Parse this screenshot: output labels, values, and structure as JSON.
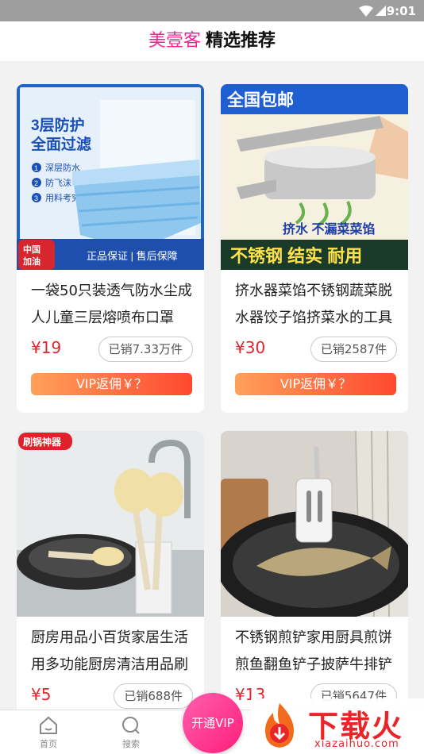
{
  "status_bar": {
    "time": "9:01"
  },
  "header": {
    "brand": "美壹客",
    "title": "精选推荐"
  },
  "products": [
    {
      "image": {
        "kind": "face-mask",
        "headline": "3层防护\n全面过滤",
        "features": [
          "深层防水",
          "防飞沫",
          "用料考究"
        ],
        "feature_numbers": [
          "1",
          "2",
          "3"
        ],
        "corner_badge": "中国\n加油",
        "bottom_banner": "正品保证 | 售后保障"
      },
      "name": "一袋50只装透气防水尘成人儿童三层熔喷布口罩",
      "price": "¥19",
      "sold": "已销7.33万件",
      "vip_label": "VIP返佣￥？"
    },
    {
      "image": {
        "kind": "steel-press",
        "top_banner": "全国包邮",
        "tagline": "挤水 不漏菜菜馅",
        "bottom_banner": "不锈钢 结实 耐用"
      },
      "name": "挤水器菜馅不锈钢蔬菜脱水器饺子馅挤菜水的工具",
      "price": "¥30",
      "sold": "已销2587件",
      "vip_label": "VIP返佣￥？"
    },
    {
      "image": {
        "kind": "pan-brush",
        "corner_badge": "刷锅神器"
      },
      "name": "厨房用品小百货家居生活用多功能厨房清洁用品刷锅",
      "price": "¥5",
      "sold": "已销688件",
      "vip_label": ""
    },
    {
      "image": {
        "kind": "fish-spatula"
      },
      "name": "不锈钢煎铲家用厨具煎饼煎鱼翻鱼铲子披萨牛排铲",
      "price": "¥13",
      "sold": "已销5647件",
      "vip_label": ""
    }
  ],
  "tab_bar": {
    "tabs": [
      {
        "label": "首页",
        "icon": "home-icon"
      },
      {
        "label": "搜索",
        "icon": "search-icon"
      }
    ],
    "center_button": "开通VIP"
  },
  "watermark": {
    "text": "下载火",
    "url": "xiazaihuo.com"
  },
  "colors": {
    "brand": "#ff1f8f",
    "price": "#e6242e",
    "vip_gradient_start": "#ffa05a",
    "vip_gradient_end": "#ff4830"
  }
}
